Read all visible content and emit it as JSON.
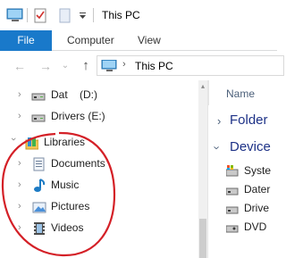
{
  "window": {
    "title": "This PC"
  },
  "quick_access": {
    "icons": [
      "computer-icon",
      "properties-checklist-icon",
      "new-folder-icon",
      "customize-dropdown-icon"
    ]
  },
  "ribbon": {
    "tabs": [
      {
        "label": "File",
        "active": true
      },
      {
        "label": "Computer"
      },
      {
        "label": "View"
      }
    ]
  },
  "address_bar": {
    "back_icon": "←",
    "forward_icon": "→",
    "recent_icon": "⌄",
    "up_icon": "↑",
    "separator": "›",
    "location": "This PC"
  },
  "nav_pane": {
    "items": [
      {
        "label": "Dat    (D:)",
        "icon": "drive-icon",
        "expanded": false
      },
      {
        "label": "Drivers (E:)",
        "icon": "drive-icon",
        "expanded": false
      },
      {
        "label": "Libraries",
        "icon": "libraries-icon",
        "expanded": true
      },
      {
        "label": "Documents",
        "icon": "documents-icon",
        "expanded": false
      },
      {
        "label": "Music",
        "icon": "music-icon",
        "expanded": false
      },
      {
        "label": "Pictures",
        "icon": "pictures-icon",
        "expanded": false
      },
      {
        "label": "Videos",
        "icon": "videos-icon",
        "expanded": false
      }
    ]
  },
  "content_pane": {
    "column_header": "Name",
    "groups": [
      {
        "label": "Folder",
        "expanded": false
      },
      {
        "label": "Device",
        "expanded": true
      }
    ],
    "device_items": [
      {
        "label": "Syste",
        "icon": "system-drive-icon"
      },
      {
        "label": "Dater",
        "icon": "drive-icon"
      },
      {
        "label": "Drive",
        "icon": "drive-icon"
      },
      {
        "label": "DVD",
        "icon": "dvd-drive-icon"
      }
    ]
  },
  "colors": {
    "file_tab": "#1979ca",
    "group_label": "#1e3287",
    "annotation": "#d42027"
  }
}
